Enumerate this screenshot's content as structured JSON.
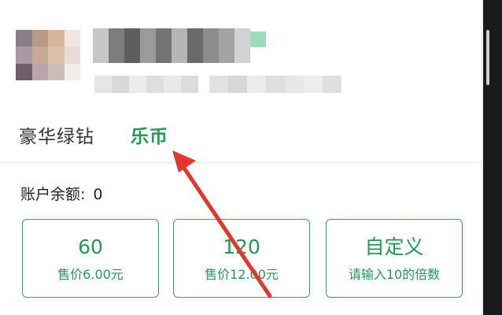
{
  "tabs": {
    "premium_label": "豪华绿钻",
    "coin_label": "乐币"
  },
  "account": {
    "balance_label": "账户余额:",
    "balance_value": "0"
  },
  "options": [
    {
      "amount": "60",
      "price": "售价6.00元"
    },
    {
      "amount": "120",
      "price": "售价12.00元"
    },
    {
      "amount": "自定义",
      "price": "请输入10的倍数"
    }
  ],
  "colors": {
    "accent_green": "#1f9b55",
    "border_green": "#2daa62",
    "annotation_red": "#e8342c"
  }
}
